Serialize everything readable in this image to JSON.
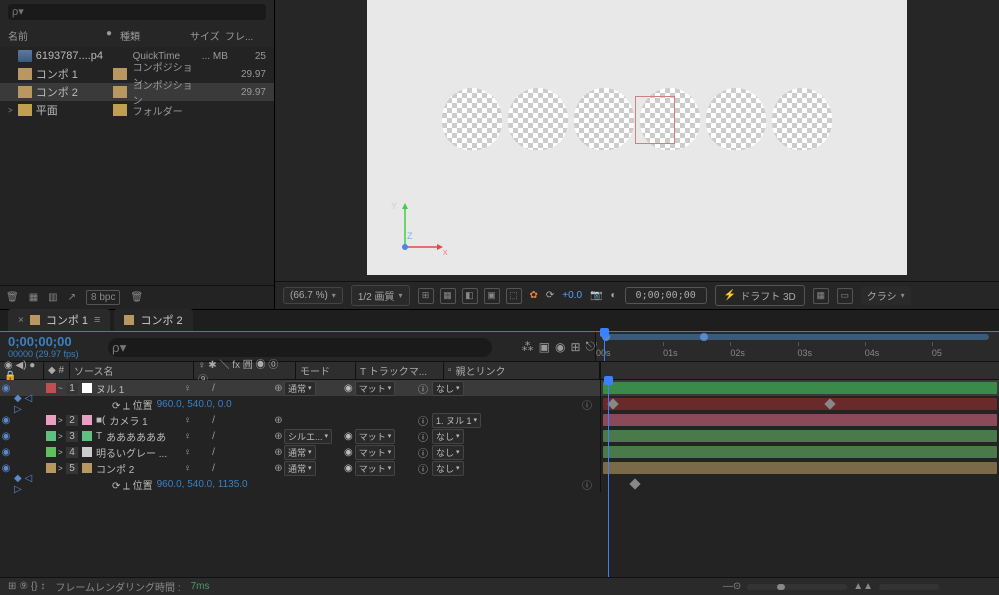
{
  "project": {
    "searchPlaceholder": "ρ▾",
    "columns": {
      "name": "名前",
      "label": "●",
      "type": "種類",
      "size": "サイズ",
      "fps": "フレ..."
    },
    "items": [
      {
        "name": "6193787....p4",
        "type": "QuickTime",
        "size": "... MB",
        "fps": "25",
        "iconClass": "qt-icon",
        "selected": false
      },
      {
        "name": "コンポ 1",
        "type": "コンポジション",
        "size": "",
        "fps": "29.97",
        "iconClass": "comp-icon",
        "tiClass": "comp-icon",
        "selected": false
      },
      {
        "name": "コンポ 2",
        "type": "コンポジション",
        "size": "",
        "fps": "29.97",
        "iconClass": "comp-icon",
        "tiClass": "comp-icon",
        "selected": true
      },
      {
        "name": "平面",
        "type": "フォルダー",
        "size": "",
        "fps": "",
        "iconClass": "folder-icon",
        "tiClass": "folder-icon",
        "tri": ">",
        "selected": false
      }
    ],
    "footer": {
      "bpc": "8 bpc"
    }
  },
  "viewer": {
    "axes": {
      "x": "x",
      "y": "Y",
      "z": "Z"
    },
    "footer": {
      "zoom": "(66.7 %)",
      "quality": "1/2 画質",
      "exposure": "+0.0",
      "timecode": "0;00;00;00",
      "draft": "ドラフト 3D",
      "classic": "クラシ"
    }
  },
  "timeline": {
    "tabs": [
      {
        "label": "コンポ 1",
        "active": true
      },
      {
        "label": "コンポ 2",
        "active": false
      }
    ],
    "timecode": "0;00;00;00",
    "frames": "00000 (29.97 fps)",
    "searchPlaceholder": "ρ▾",
    "ruler": [
      "00s",
      "01s",
      "02s",
      "03s",
      "04s",
      "05"
    ],
    "columns": {
      "srcName": "ソース名",
      "switches": "♀ ✱ ＼ fx 圓 ◉ ⓪ ⑨",
      "mode": "モード",
      "track": "T トラックマ...",
      "parent": "親とリンク"
    },
    "layers": [
      {
        "num": "1",
        "name": "ヌル 1",
        "boxColor": "#fff",
        "swColor": "#c05050",
        "mode": "通常",
        "mat": "マット",
        "parent": "なし",
        "barColor": "#3a8a4a",
        "sel": true
      },
      {
        "prop": true,
        "label": "位置",
        "value": "960.0, 540.0, 0.0",
        "barColor": "#6a2a2a",
        "kf1": 8,
        "kf2": 225
      },
      {
        "num": "2",
        "name": "カメラ 1",
        "icon": "■(",
        "boxColor": "#e8a0c0",
        "swColor": "#e8a0c0",
        "parent": "1. ヌル 1",
        "barColor": "#8a4a5a"
      },
      {
        "num": "3",
        "name": "ああああああ",
        "icon": "T",
        "boxColor": "#60c080",
        "swColor": "#60c080",
        "mode": "シルエ...",
        "mat": "マット",
        "parent": "なし",
        "barColor": "#4a7a4a"
      },
      {
        "num": "4",
        "name": "明るいグレー ...",
        "boxColor": "#ccc",
        "swColor": "#60c060",
        "mode": "通常",
        "mat": "マット",
        "parent": "なし",
        "barColor": "#4a7a4a"
      },
      {
        "num": "5",
        "name": "コンポ 2",
        "boxColor": "#b89860",
        "swColor": "#b89860",
        "mode": "通常",
        "mat": "マット",
        "parent": "なし",
        "barColor": "#7a6a4a"
      },
      {
        "prop": true,
        "label": "位置",
        "value": "960.0, 540.0, 1135.0",
        "barColor": "transparent",
        "kf1": 30
      }
    ],
    "footer": {
      "renderTimeLabel": "フレームレンダリング時間 :",
      "renderTime": "7ms"
    }
  }
}
